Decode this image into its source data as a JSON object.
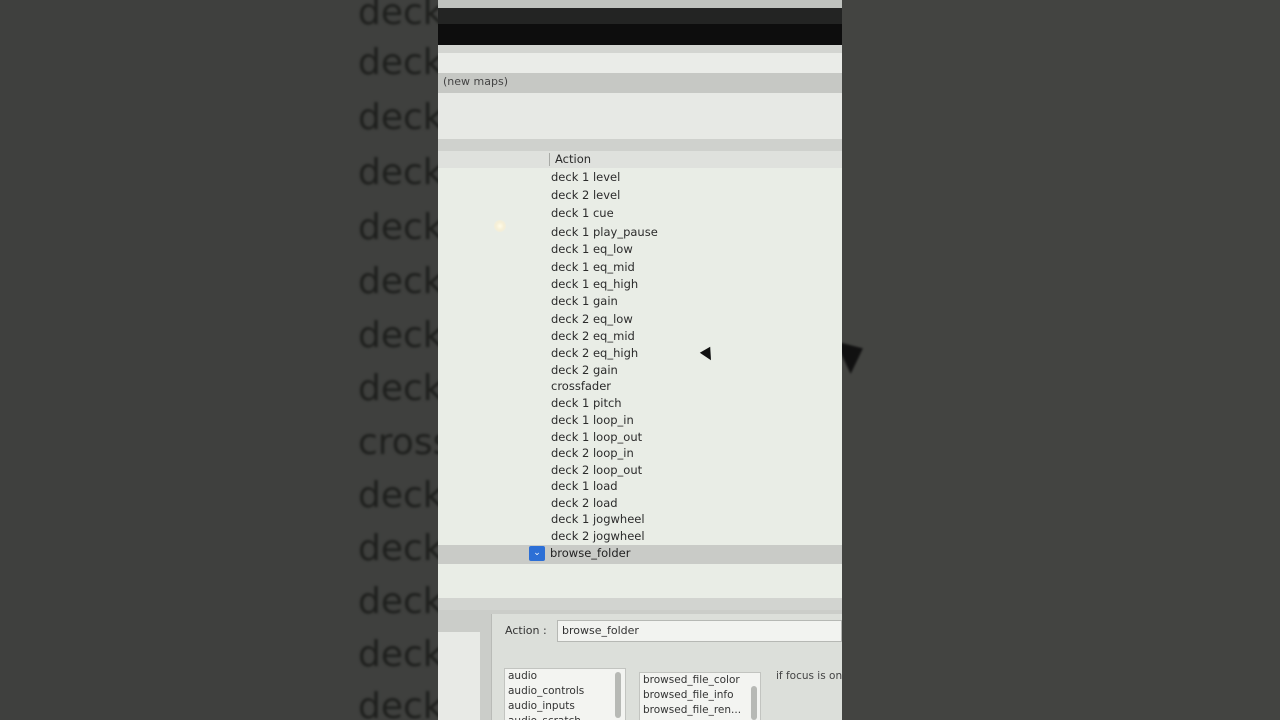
{
  "background": {
    "words": [
      "deck",
      "deck",
      "deck",
      "deck",
      "deck",
      "deck",
      "deck",
      "deck",
      "cross",
      "deck",
      "deck",
      "deck",
      "deck",
      "deck"
    ]
  },
  "maps": {
    "label": "(new maps)"
  },
  "table": {
    "column_header": "Action",
    "items": [
      "deck 1 level",
      "deck 2 level",
      "deck 1 cue",
      "deck 1 play_pause",
      "deck 1 eq_low",
      "deck 1 eq_mid",
      "deck 1 eq_high",
      "deck 1 gain",
      "deck 2 eq_low",
      "deck 2 eq_mid",
      "deck 2 eq_high",
      "deck 2 gain",
      "crossfader",
      "deck 1 pitch",
      "deck 1 loop_in",
      "deck 1 loop_out",
      "deck 2 loop_in",
      "deck 2 loop_out",
      "deck 1 load",
      "deck 2 load",
      "deck 1 jogwheel",
      "deck 2 jogwheel"
    ],
    "selected_item": "browse_folder",
    "selected_icon": "chevron-down-icon"
  },
  "editor": {
    "action_label": "Action :",
    "action_value": "browse_folder",
    "categories": [
      "audio",
      "audio_controls",
      "audio_inputs",
      "audio_scratch"
    ],
    "functions": [
      "browsed_file_color",
      "browsed_file_info",
      "browsed_file_ren..."
    ],
    "hint": "if focus is on"
  },
  "colors": {
    "selection_check": "#2c6fd6"
  }
}
